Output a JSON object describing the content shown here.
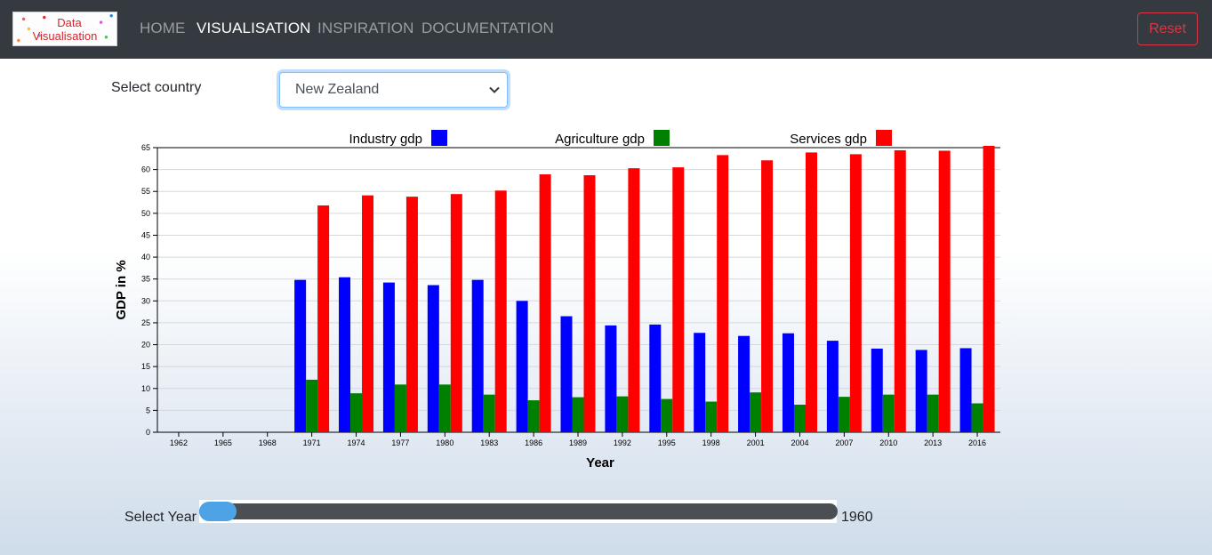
{
  "nav": {
    "logo_line1": "Data",
    "logo_line2": "Visualisation",
    "items": [
      {
        "label": "HOME",
        "active": false
      },
      {
        "label": "VISUALISATION",
        "active": true
      },
      {
        "label": "INSPIRATION",
        "active": false
      },
      {
        "label": "DOCUMENTATION",
        "active": false
      }
    ],
    "reset_label": "Reset"
  },
  "controls": {
    "country_label": "Select country",
    "country_value": "New Zealand",
    "year_label": "Select Year",
    "year_value": "1960",
    "year_slider_position": 0.0
  },
  "colors": {
    "industry": "#0000ff",
    "agriculture": "#008000",
    "services": "#ff0000",
    "reset": "#dc3545",
    "slider_thumb": "#4ea3e6"
  },
  "chart_data": {
    "type": "bar",
    "xlabel": "Year",
    "ylabel": "GDP in %",
    "ylim": [
      0,
      65
    ],
    "yticks": [
      0,
      5,
      10,
      15,
      20,
      25,
      30,
      35,
      40,
      45,
      50,
      55,
      60,
      65
    ],
    "grid": true,
    "legend_position": "top",
    "categories": [
      "1962",
      "1965",
      "1968",
      "1971",
      "1974",
      "1977",
      "1980",
      "1983",
      "1986",
      "1989",
      "1992",
      "1995",
      "1998",
      "2001",
      "2004",
      "2007",
      "2010",
      "2013",
      "2016"
    ],
    "series": [
      {
        "name": "Industry gdp",
        "color": "#0000ff",
        "values": [
          null,
          null,
          null,
          34.8,
          35.4,
          34.2,
          33.6,
          34.8,
          30.0,
          26.5,
          24.4,
          24.6,
          22.7,
          22.0,
          22.6,
          20.9,
          19.1,
          18.8,
          19.2
        ]
      },
      {
        "name": "Agriculture gdp",
        "color": "#008000",
        "values": [
          null,
          null,
          null,
          12.0,
          8.9,
          10.9,
          10.9,
          8.6,
          7.3,
          8.0,
          8.2,
          7.6,
          7.0,
          9.1,
          6.3,
          8.1,
          8.6,
          8.6,
          6.6
        ]
      },
      {
        "name": "Services gdp",
        "color": "#ff0000",
        "values": [
          null,
          null,
          null,
          51.8,
          54.1,
          53.8,
          54.4,
          55.2,
          58.9,
          58.7,
          60.3,
          60.5,
          63.3,
          62.1,
          63.9,
          63.5,
          64.4,
          64.3,
          65.7
        ]
      }
    ]
  }
}
